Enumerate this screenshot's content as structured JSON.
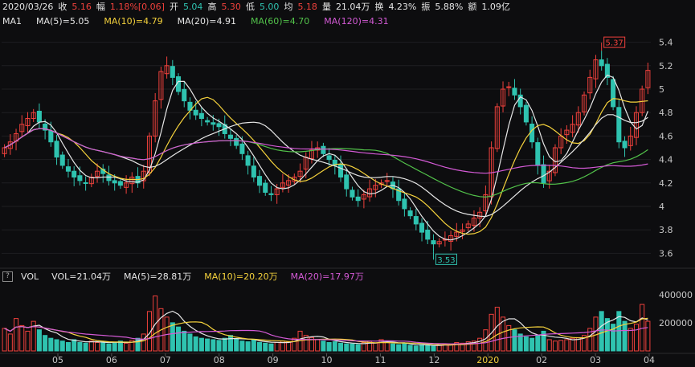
{
  "header": {
    "date": "2020/03/26",
    "close_label": "收",
    "close": "5.16",
    "change_label": "幅",
    "change": "1.18%[0.06]",
    "open_label": "开",
    "open": "5.04",
    "high_label": "高",
    "high": "5.30",
    "low_label": "低",
    "low": "5.00",
    "avg_label": "均",
    "avg": "5.18",
    "volume_label": "量",
    "volume": "21.04万",
    "turnover_label": "换",
    "turnover": "4.23%",
    "amplitude_label": "振",
    "amplitude": "5.88%",
    "amount_label": "额",
    "amount": "1.09亿"
  },
  "ma_legend": {
    "name": "MA1",
    "ma5": "MA(5)=5.05",
    "ma10": "MA(10)=4.79",
    "ma20": "MA(20)=4.91",
    "ma60": "MA(60)=4.70",
    "ma120": "MA(120)=4.31"
  },
  "vol_legend": {
    "help": "?",
    "name": "VOL",
    "vol": "VOL=21.04万",
    "ma5": "MA(5)=28.81万",
    "ma10": "MA(10)=20.20万",
    "ma20": "MA(20)=17.97万"
  },
  "colors": {
    "up": "#f0413c",
    "down": "#2fc3b0",
    "ma5": "#e6e6e6",
    "ma10": "#f5d23c",
    "ma20": "#e6e6e6",
    "ma60": "#52c24a",
    "ma120": "#d45ad6",
    "bg": "#0d0d0f",
    "grid": "#1e1e22"
  },
  "chart_data": [
    {
      "type": "candlestick",
      "price_axis_ticks": [
        "5.4",
        "5.2",
        "5",
        "4.8",
        "4.6",
        "4.4",
        "4.2",
        "4",
        "3.8",
        "3.6"
      ],
      "ylim": [
        3.5,
        5.5
      ],
      "annotations": {
        "max_label": "5.37",
        "min_label": "3.53"
      },
      "x_tick_labels": [
        "05",
        "06",
        "07",
        "08",
        "09",
        "10",
        "11",
        "12",
        "2020",
        "02",
        "03",
        "04"
      ],
      "close_series": [
        4.5,
        4.55,
        4.62,
        4.7,
        4.75,
        4.8,
        4.72,
        4.65,
        4.55,
        4.42,
        4.35,
        4.3,
        4.25,
        4.22,
        4.2,
        4.25,
        4.3,
        4.28,
        4.22,
        4.2,
        4.18,
        4.2,
        4.25,
        4.2,
        4.3,
        4.6,
        4.9,
        5.15,
        5.2,
        5.1,
        4.98,
        4.9,
        4.82,
        4.78,
        4.75,
        4.72,
        4.7,
        4.68,
        4.62,
        4.58,
        4.52,
        4.45,
        4.35,
        4.25,
        4.18,
        4.12,
        4.1,
        4.15,
        4.2,
        4.22,
        4.25,
        4.3,
        4.42,
        4.48,
        4.5,
        4.45,
        4.4,
        4.35,
        4.25,
        4.15,
        4.08,
        4.05,
        4.1,
        4.15,
        4.18,
        4.2,
        4.22,
        4.15,
        4.05,
        3.98,
        3.92,
        3.85,
        3.78,
        3.72,
        3.68,
        3.7,
        3.72,
        3.75,
        3.78,
        3.8,
        3.85,
        3.9,
        3.95,
        4.1,
        4.5,
        4.85,
        5.0,
        5.02,
        4.95,
        4.85,
        4.72,
        4.55,
        4.35,
        4.2,
        4.3,
        4.5,
        4.6,
        4.65,
        4.7,
        4.8,
        4.95,
        5.1,
        5.25,
        5.2,
        5.1,
        4.85,
        4.55,
        4.5,
        4.6,
        4.8,
        5.0,
        5.16
      ]
    },
    {
      "type": "bar",
      "name": "VOL",
      "axis_ticks": [
        "400000",
        "200000"
      ],
      "ylim": [
        0,
        450000
      ],
      "values": [
        160000,
        120000,
        230000,
        180000,
        140000,
        210000,
        150000,
        110000,
        90000,
        80000,
        70000,
        60000,
        80000,
        60000,
        55000,
        70000,
        60000,
        65000,
        50000,
        60000,
        70000,
        55000,
        75000,
        90000,
        120000,
        280000,
        390000,
        300000,
        240000,
        200000,
        170000,
        140000,
        120000,
        100000,
        90000,
        85000,
        80000,
        75000,
        90000,
        110000,
        85000,
        70000,
        65000,
        80000,
        60000,
        55000,
        50000,
        60000,
        70000,
        65000,
        90000,
        140000,
        110000,
        95000,
        80000,
        70000,
        60000,
        65000,
        55000,
        50000,
        50000,
        45000,
        60000,
        70000,
        55000,
        80000,
        60000,
        50000,
        45000,
        55000,
        40000,
        35000,
        45000,
        40000,
        35000,
        40000,
        50000,
        45000,
        60000,
        55000,
        65000,
        70000,
        90000,
        150000,
        260000,
        310000,
        240000,
        180000,
        150000,
        120000,
        100000,
        90000,
        110000,
        140000,
        80000,
        70000,
        75000,
        80000,
        90000,
        95000,
        110000,
        160000,
        240000,
        280000,
        230000,
        190000,
        280000,
        210000,
        160000,
        190000,
        330000,
        210400
      ]
    }
  ]
}
